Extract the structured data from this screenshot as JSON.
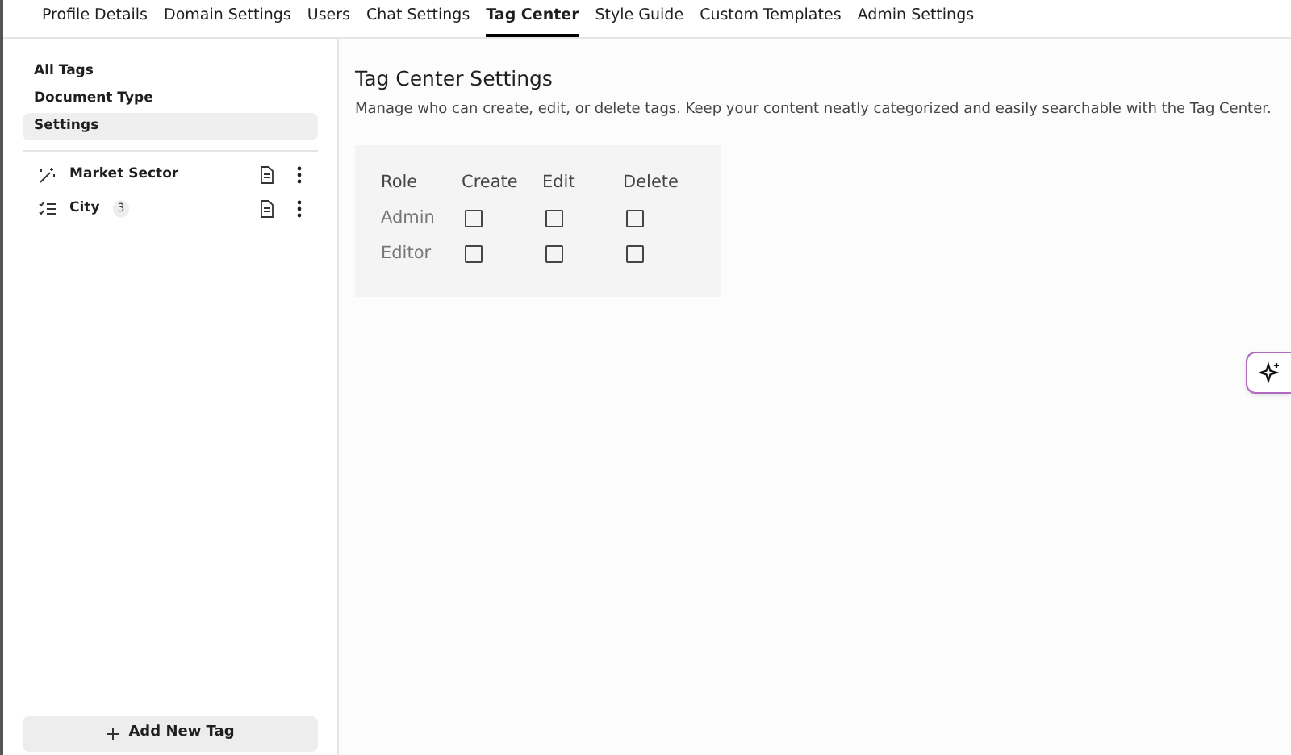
{
  "tabs": [
    {
      "label": "Profile Details",
      "selected": false
    },
    {
      "label": "Domain Settings",
      "selected": false
    },
    {
      "label": "Users",
      "selected": false
    },
    {
      "label": "Chat Settings",
      "selected": false
    },
    {
      "label": "Tag Center",
      "selected": true
    },
    {
      "label": "Style Guide",
      "selected": false
    },
    {
      "label": "Custom Templates",
      "selected": false
    },
    {
      "label": "Admin Settings",
      "selected": false
    }
  ],
  "sidebar": {
    "nav": [
      {
        "label": "All Tags",
        "selected": false
      },
      {
        "label": "Document Type",
        "selected": false
      },
      {
        "label": "Settings",
        "selected": true
      }
    ],
    "tags": [
      {
        "name": "Market Sector"
      },
      {
        "name": "City",
        "count": "3"
      }
    ],
    "add_button": "Add New Tag"
  },
  "content": {
    "title": "Tag Center Settings",
    "description": "Manage who can create, edit, or delete tags. Keep your content neatly categorized and easily searchable with the Tag Center.",
    "permissions": {
      "columns": [
        "Role",
        "Create",
        "Edit",
        "Delete"
      ],
      "rows": [
        {
          "role": "Admin",
          "checks": [
            {
              "checked": false
            },
            {
              "checked": false
            },
            {
              "checked": false
            }
          ]
        },
        {
          "role": "Editor",
          "checks": [
            {
              "checked": false
            },
            {
              "checked": false
            },
            {
              "checked": false
            }
          ]
        }
      ]
    }
  }
}
